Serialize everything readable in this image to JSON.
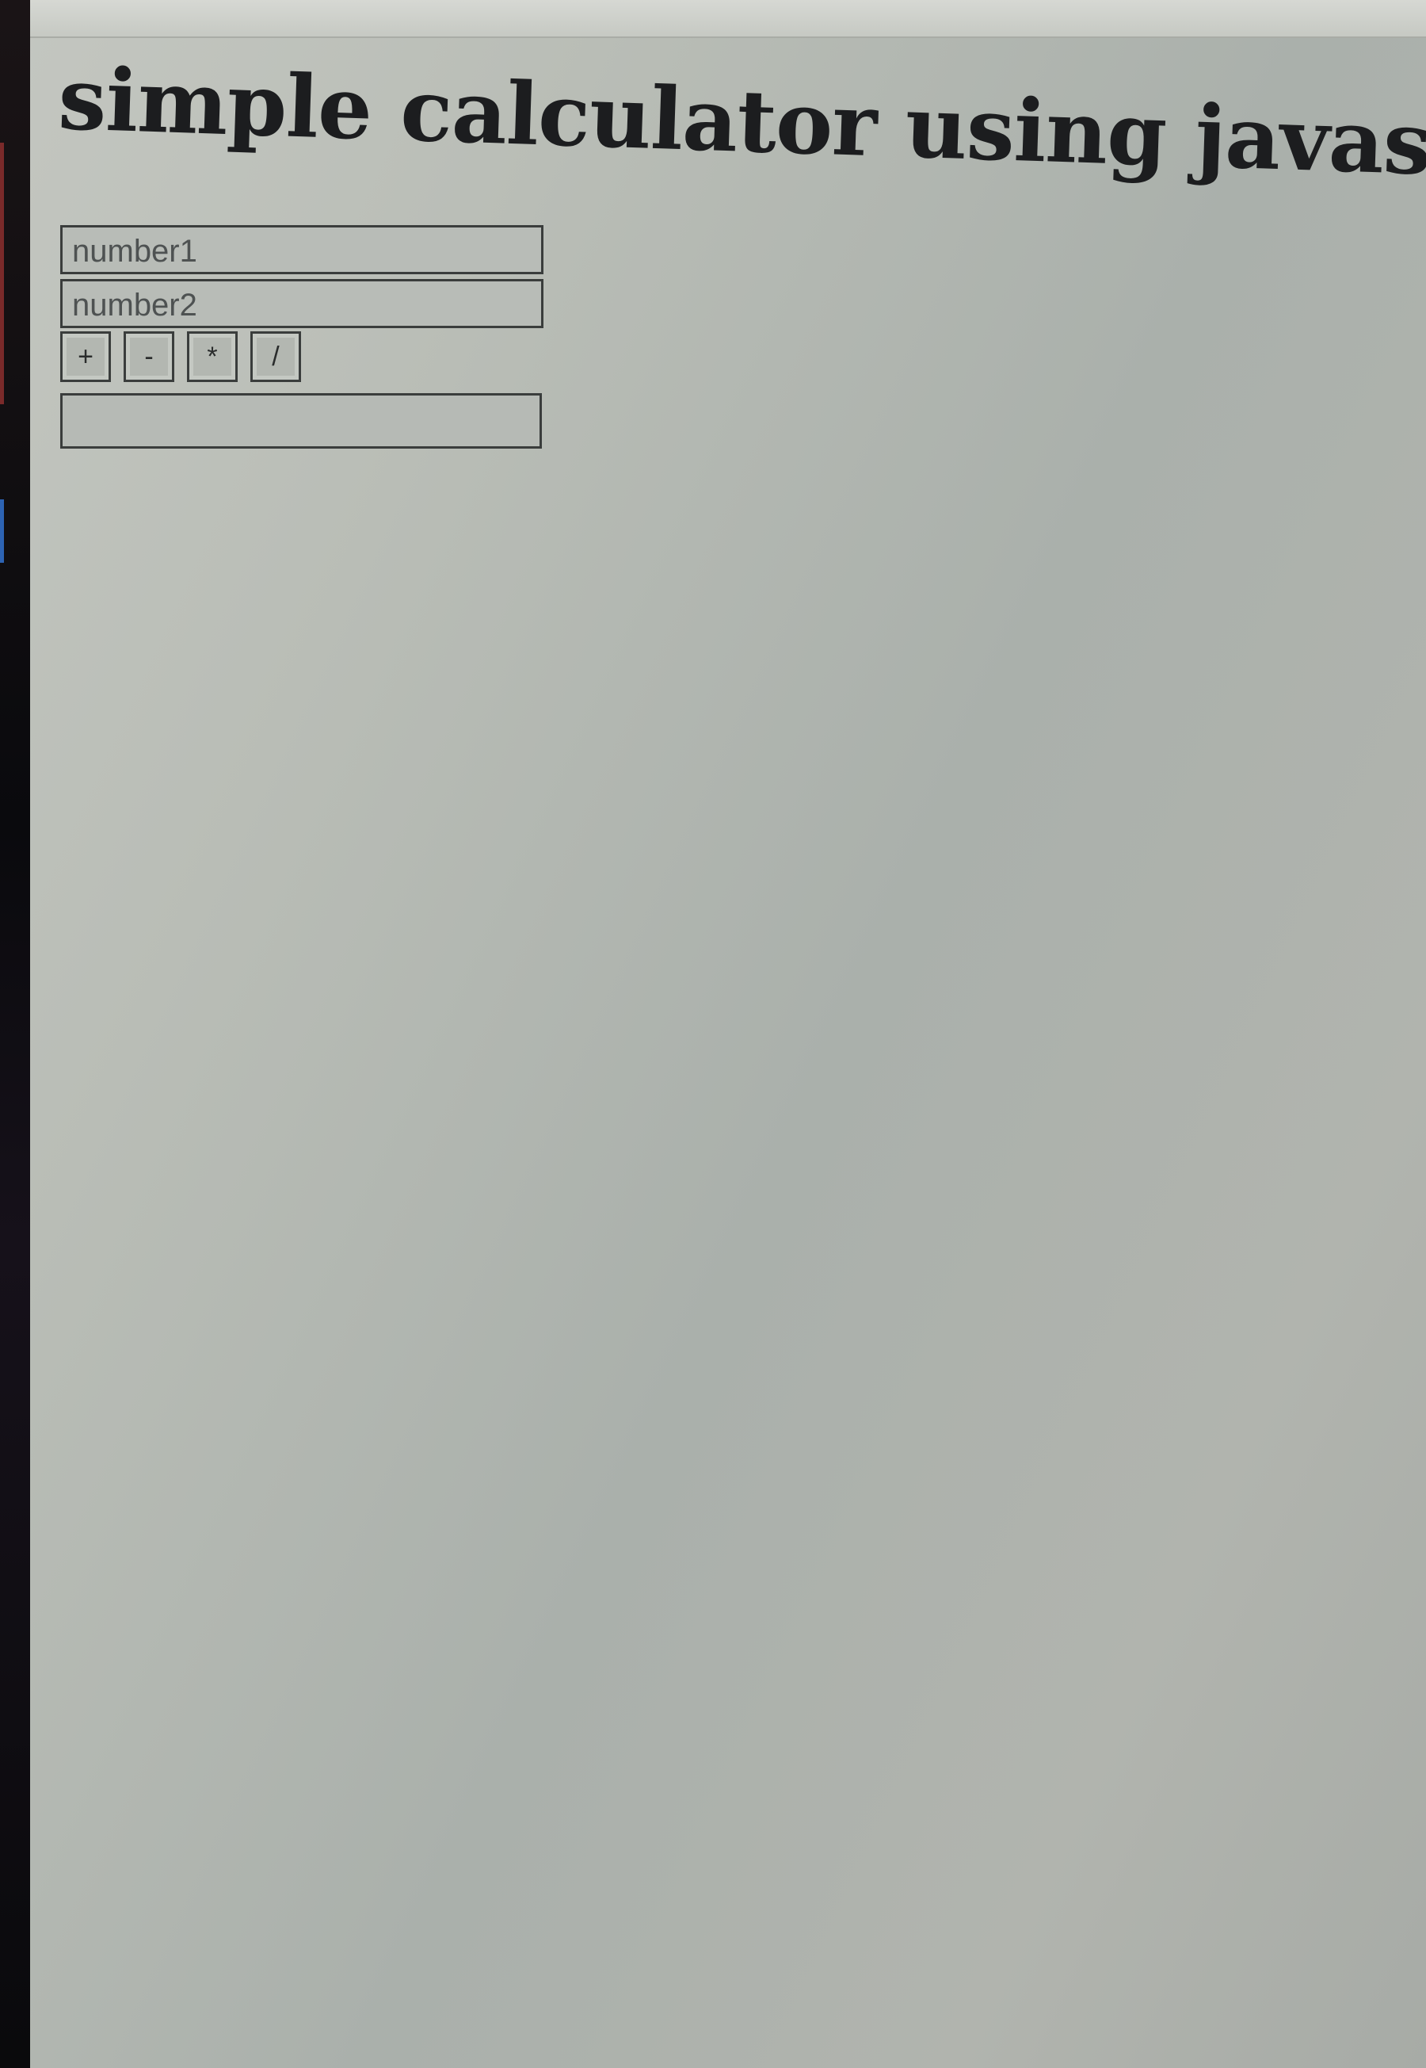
{
  "page": {
    "title": "simple calculator using javascript"
  },
  "form": {
    "number1_placeholder": "number1",
    "number2_placeholder": "number2",
    "result_value": ""
  },
  "operations": {
    "add_label": "+",
    "subtract_label": "-",
    "multiply_label": "*",
    "divide_label": "/"
  },
  "colors": {
    "page_background": "#b9bdb6",
    "text": "#1c1d1f",
    "border": "#3a3d3c"
  }
}
